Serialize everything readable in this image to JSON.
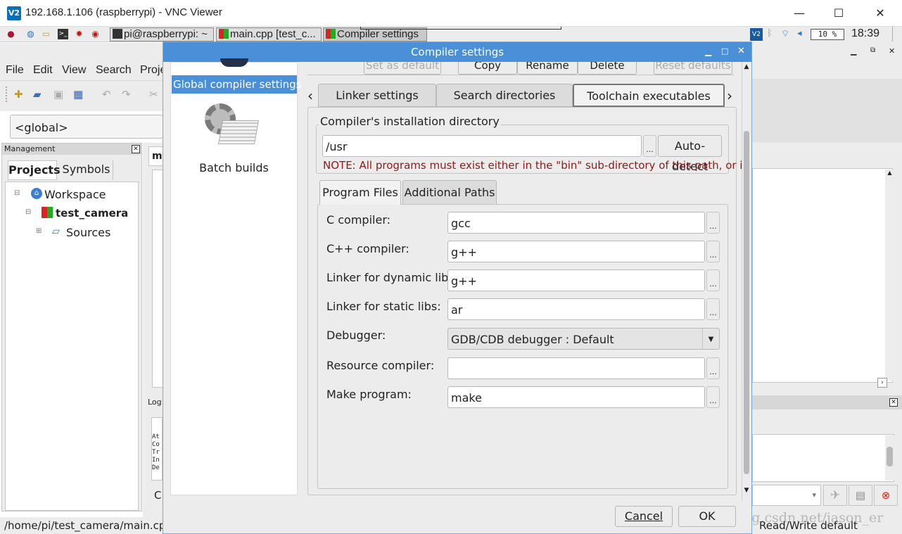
{
  "window": {
    "title": "192.168.1.106 (raspberrypi) - VNC Viewer",
    "logo": "V2",
    "minimize": "—",
    "maximize": "☐",
    "close": "✕"
  },
  "taskbar": {
    "tasks": [
      "pi@raspberrypi: ~",
      "main.cpp [test_c...",
      "Compiler settings"
    ],
    "volume": "10 %",
    "clock": "18:39",
    "icons": [
      "raspberry-menu-icon",
      "web-browser-icon",
      "file-manager-icon",
      "terminal-icon",
      "math-kernel-icon",
      "wolfram-icon",
      "vnc-tray-icon",
      "bluetooth-icon",
      "wifi-icon",
      "volume-icon"
    ]
  },
  "ide": {
    "menu": [
      "File",
      "Edit",
      "View",
      "Search",
      "Proje"
    ],
    "scope_combo": "<global>",
    "management": {
      "title": "Management",
      "tabs": [
        "Projects",
        "Symbols"
      ],
      "tree": [
        "Workspace",
        "test_camera",
        "Sources"
      ]
    },
    "editor_tab_partial": "m",
    "logs_label": "Log",
    "log_lines": [
      "At",
      "Co",
      "Tr",
      "In",
      "De"
    ],
    "log_partial": "C",
    "status_path": "/home/pi/test_camera/main.cpp",
    "status_mode": "Read/Write  default",
    "watermark": "https://blog.csdn.net/jason_er"
  },
  "dialog": {
    "title": "Compiler settings",
    "left_items": [
      "Global compiler settings",
      "Batch builds"
    ],
    "top_buttons": [
      "Set as default",
      "Copy",
      "Rename",
      "Delete",
      "Reset defaults"
    ],
    "tabs": [
      "Linker settings",
      "Search directories",
      "Toolchain executables"
    ],
    "install_dir": {
      "group_label": "Compiler's installation directory",
      "value": "/usr",
      "browse": "...",
      "autodetect": "Auto-detect",
      "note": "NOTE: All programs must exist either in the \"bin\" sub-directory of this path, or in"
    },
    "subtabs": [
      "Program Files",
      "Additional Paths"
    ],
    "fields": [
      {
        "label": "C compiler:",
        "value": "gcc"
      },
      {
        "label": "C++ compiler:",
        "value": "g++"
      },
      {
        "label": "Linker for dynamic libs:",
        "value": "g++"
      },
      {
        "label": "Linker for static libs:",
        "value": "ar"
      },
      {
        "label": "Debugger:",
        "value": "GDB/CDB debugger : Default"
      },
      {
        "label": "Resource compiler:",
        "value": ""
      },
      {
        "label": "Make program:",
        "value": "make"
      }
    ],
    "cancel": "Cancel",
    "ok": "OK"
  }
}
